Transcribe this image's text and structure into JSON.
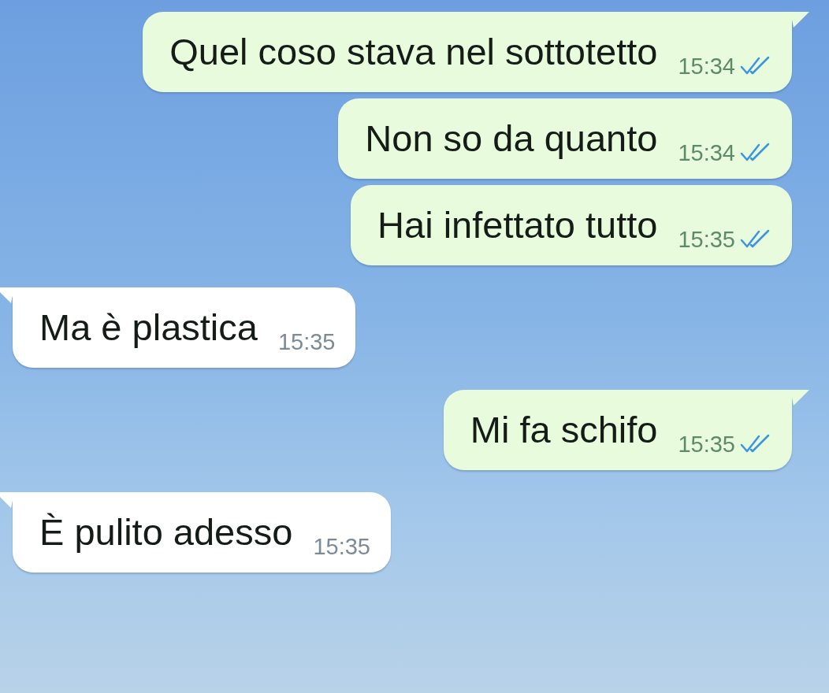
{
  "messages": [
    {
      "kind": "outgoing",
      "text": "Quel coso stava nel sottotetto",
      "time": "15:34",
      "read": true,
      "tail": true
    },
    {
      "kind": "outgoing",
      "text": "Non so da quanto",
      "time": "15:34",
      "read": true,
      "tail": false
    },
    {
      "kind": "outgoing",
      "text": "Hai infettato tutto",
      "time": "15:35",
      "read": true,
      "tail": false
    },
    {
      "kind": "incoming",
      "text": "Ma è plastica",
      "time": "15:35",
      "tail": true
    },
    {
      "kind": "outgoing",
      "text": "Mi fa schifo",
      "time": "15:35",
      "read": true,
      "tail": true
    },
    {
      "kind": "incoming",
      "text": "È pulito adesso",
      "time": "15:35",
      "tail": true
    }
  ]
}
